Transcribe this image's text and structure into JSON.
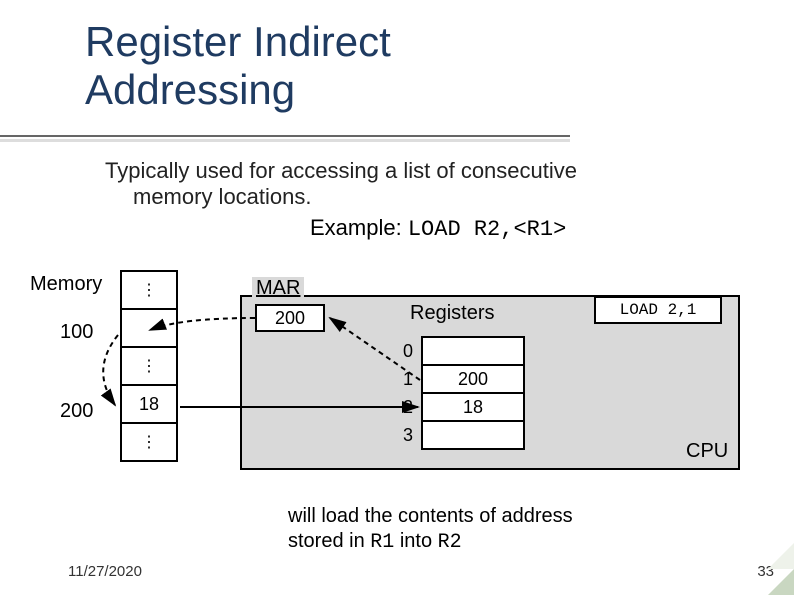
{
  "title_line1": "Register Indirect",
  "title_line2": "Addressing",
  "desc_line1": "Typically used for accessing a list of consecutive",
  "desc_line2": "memory locations.",
  "example_label": "Example:",
  "example_code": "LOAD R2,<R1>",
  "memory_label": "Memory",
  "mem": {
    "dots": "⋮",
    "addr100": "100",
    "val100": "",
    "addr200": "200",
    "val200": "18"
  },
  "cpu": {
    "mar_label": "MAR",
    "mar_value": "200",
    "registers_label": "Registers",
    "instruction": "LOAD 2,1",
    "cpu_label": "CPU",
    "rows": [
      {
        "idx": "0",
        "val": ""
      },
      {
        "idx": "1",
        "val": "200"
      },
      {
        "idx": "2",
        "val": "18"
      },
      {
        "idx": "3",
        "val": ""
      }
    ]
  },
  "footnote_a": "will load the contents of address",
  "footnote_b": "stored in ",
  "footnote_r1": "R1",
  "footnote_c": " into ",
  "footnote_r2": "R2",
  "date": "11/27/2020",
  "slide_no": "33"
}
